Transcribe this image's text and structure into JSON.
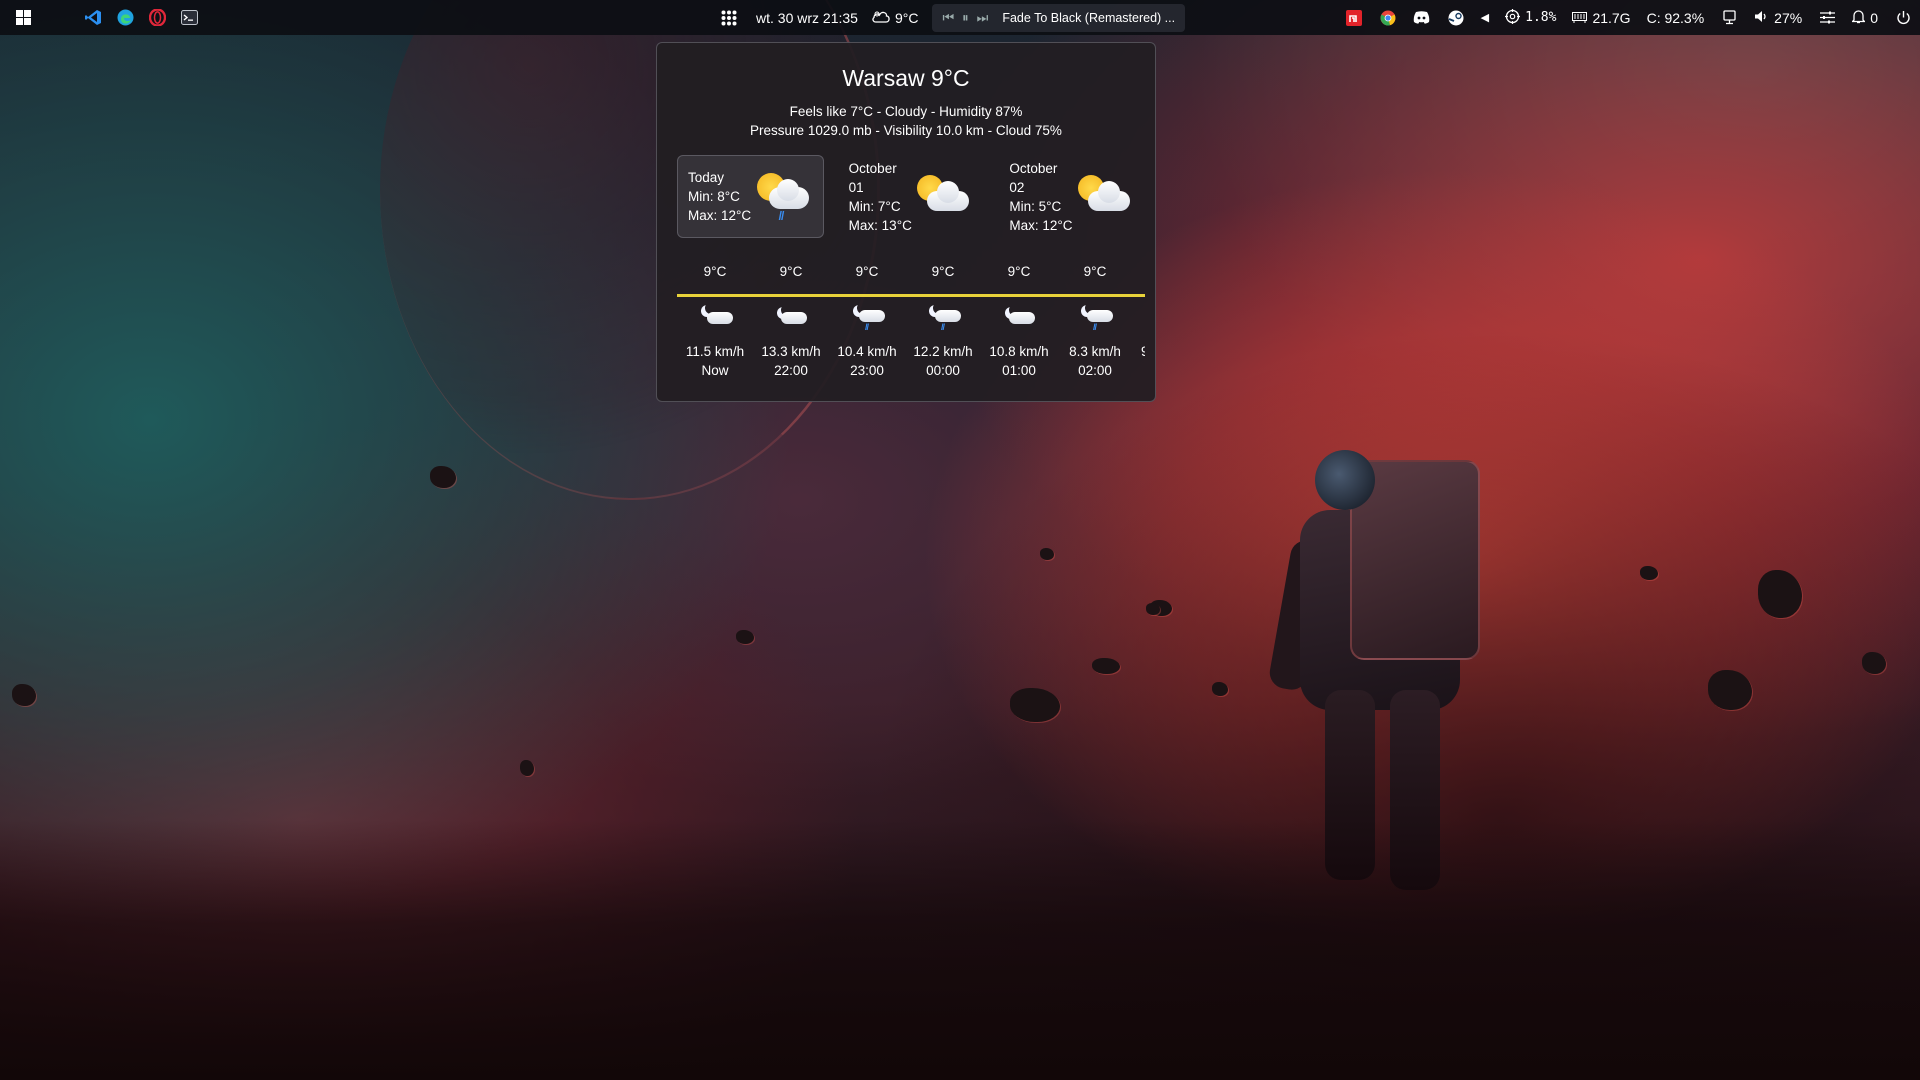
{
  "taskbar": {
    "left_icons": [
      "windows-start-icon",
      "vscode-icon",
      "edge-icon",
      "opera-icon",
      "terminal-icon"
    ],
    "apps_grid_icon": "apps-grid-icon",
    "datetime": "wt. 30 wrz 21:35",
    "weather_temp": "9°C",
    "media": {
      "prev": "⏮",
      "pause": "⏸",
      "next": "⏭",
      "title": "Fade To Black (Remastered) ..."
    },
    "tray": {
      "arrow": "◀",
      "cpu": "1.8%",
      "ram": "21.7G",
      "disk": "C: 92.3%",
      "volume": "27%",
      "notifications": "0"
    },
    "colors": {
      "bg": "#0c0e14",
      "media_bg": "#282a32"
    }
  },
  "weather": {
    "title": "Warsaw 9°C",
    "line1": "Feels like 7°C - Cloudy - Humidity 87%",
    "line2": "Pressure 1029.0 mb - Visibility 10.0 km - Cloud 75%",
    "days": [
      {
        "name": "Today",
        "min": "Min: 8°C",
        "max": "Max: 12°C",
        "icon": "partly-cloudy-rain-icon",
        "selected": true
      },
      {
        "name": "October 01",
        "min": "Min: 7°C",
        "max": "Max: 13°C",
        "icon": "partly-cloudy-icon",
        "selected": false
      },
      {
        "name": "October 02",
        "min": "Min: 5°C",
        "max": "Max: 12°C",
        "icon": "partly-cloudy-icon",
        "selected": false
      }
    ],
    "hours": [
      {
        "temp": "9°C",
        "wind": "11.5 km/h",
        "time": "Now",
        "icon": "night-cloudy-icon"
      },
      {
        "temp": "9°C",
        "wind": "13.3 km/h",
        "time": "22:00",
        "icon": "night-cloudy-icon"
      },
      {
        "temp": "9°C",
        "wind": "10.4 km/h",
        "time": "23:00",
        "icon": "night-cloudy-rain-icon"
      },
      {
        "temp": "9°C",
        "wind": "12.2 km/h",
        "time": "00:00",
        "icon": "night-cloudy-rain-icon"
      },
      {
        "temp": "9°C",
        "wind": "10.8 km/h",
        "time": "01:00",
        "icon": "night-cloudy-icon"
      },
      {
        "temp": "9°C",
        "wind": "8.3 km/h",
        "time": "02:00",
        "icon": "night-cloudy-rain-icon"
      }
    ],
    "overflow_text": "9",
    "temp_line_color": "#e8d23a"
  }
}
